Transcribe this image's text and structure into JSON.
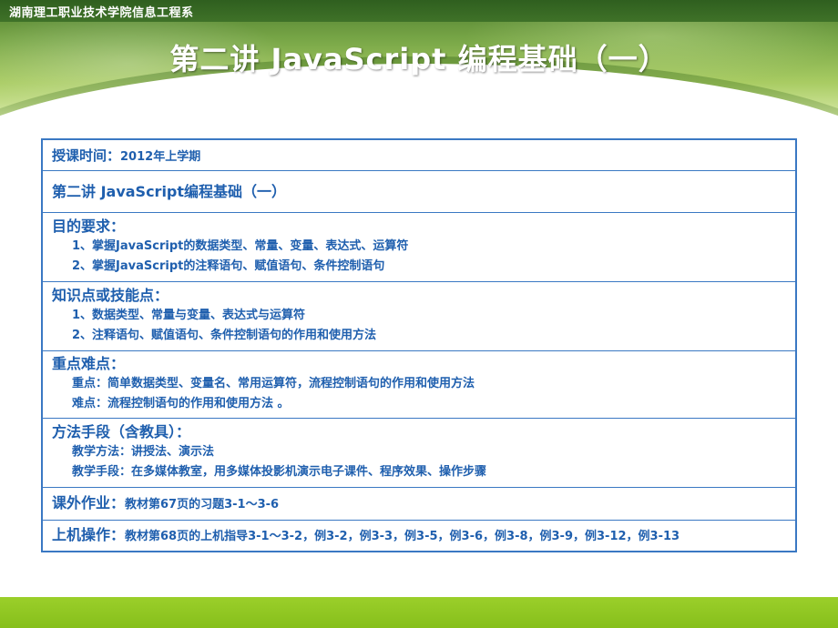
{
  "header": {
    "org_name": "湖南理工职业技术学院信息工程系",
    "slide_title": "第二讲 JavaScript 编程基础（一）"
  },
  "table": {
    "teaching_time": {
      "label": "授课时间：",
      "value": "2012年上学期"
    },
    "lecture_title": "第二讲 JavaScript编程基础（一）",
    "objectives": {
      "label": "目的要求：",
      "items": [
        "1、掌握JavaScript的数据类型、常量、变量、表达式、运算符",
        "2、掌握JavaScript的注释语句、赋值语句、条件控制语句"
      ]
    },
    "knowledge_points": {
      "label": "知识点或技能点：",
      "items": [
        "1、数据类型、常量与变量、表达式与运算符",
        "2、注释语句、赋值语句、条件控制语句的作用和使用方法"
      ]
    },
    "key_difficult": {
      "label": "重点难点：",
      "items": [
        "重点：简单数据类型、变量名、常用运算符，流程控制语句的作用和使用方法",
        "难点：流程控制语句的作用和使用方法 。"
      ]
    },
    "methods": {
      "label": "方法手段（含教具）：",
      "items": [
        "教学方法：讲授法、演示法",
        "教学手段：在多媒体教室，用多媒体投影机演示电子课件、程序效果、操作步骤"
      ]
    },
    "homework": {
      "label": "课外作业：",
      "value": "教材第67页的习题3-1～3-6"
    },
    "lab": {
      "label": "上机操作：",
      "value": "教材第68页的上机指导3-1～3-2，例3-2，例3-3，例3-5，例3-6，例3-8，例3-9，例3-12，例3-13"
    }
  }
}
